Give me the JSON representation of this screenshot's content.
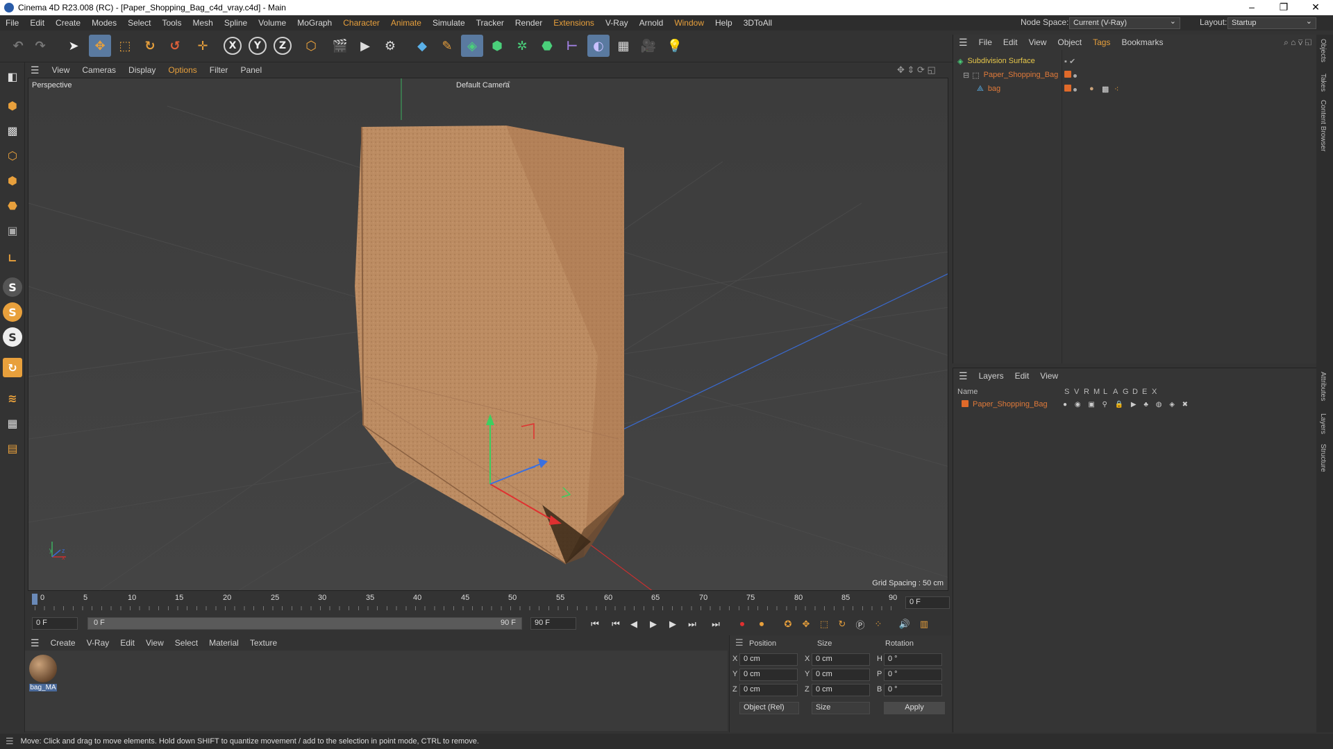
{
  "window": {
    "title": "Cinema 4D R23.008 (RC) - [Paper_Shopping_Bag_c4d_vray.c4d] - Main",
    "minimize": "–",
    "maximize": "❐",
    "close": "✕"
  },
  "menubar": {
    "items": [
      "File",
      "Edit",
      "Create",
      "Modes",
      "Select",
      "Tools",
      "Mesh",
      "Spline",
      "Volume",
      "MoGraph",
      "Character",
      "Animate",
      "Simulate",
      "Tracker",
      "Render",
      "Extensions",
      "V-Ray",
      "Arnold",
      "Window",
      "Help",
      "3DToAll"
    ],
    "node_space_label": "Node Space:",
    "node_space_value": "Current (V-Ray)",
    "layout_label": "Layout:",
    "layout_value": "Startup"
  },
  "toolbar": {
    "axis_x": "X",
    "axis_y": "Y",
    "axis_z": "Z"
  },
  "viewport_menu": {
    "items": [
      "View",
      "Cameras",
      "Display",
      "Options",
      "Filter",
      "Panel"
    ]
  },
  "viewport": {
    "view_name": "Perspective",
    "camera": "Default Camera",
    "grid_spacing": "Grid Spacing : 50 cm",
    "axis_y": "y",
    "axis_z": "z",
    "axis_x": "x"
  },
  "timeline": {
    "ticks": [
      "0",
      "5",
      "10",
      "15",
      "20",
      "25",
      "30",
      "35",
      "40",
      "45",
      "50",
      "55",
      "60",
      "65",
      "70",
      "75",
      "80",
      "85",
      "90"
    ],
    "current_frame": "0 F",
    "start_frame": "0 F",
    "range_start": "0 F",
    "range_end": "90 F",
    "end_frame": "90 F"
  },
  "material_menu": {
    "items": [
      "Create",
      "V-Ray",
      "Edit",
      "View",
      "Select",
      "Material",
      "Texture"
    ]
  },
  "materials": [
    {
      "name": "bag_MA"
    }
  ],
  "coords": {
    "headers": [
      "Position",
      "Size",
      "Rotation"
    ],
    "rows": [
      {
        "axis": "X",
        "pos": "0 cm",
        "size_axis": "X",
        "size": "0 cm",
        "rot_axis": "H",
        "rot": "0 °"
      },
      {
        "axis": "Y",
        "pos": "0 cm",
        "size_axis": "Y",
        "size": "0 cm",
        "rot_axis": "P",
        "rot": "0 °"
      },
      {
        "axis": "Z",
        "pos": "0 cm",
        "size_axis": "Z",
        "size": "0 cm",
        "rot_axis": "B",
        "rot": "0 °"
      }
    ],
    "mode": "Object (Rel)",
    "size_mode": "Size",
    "apply": "Apply"
  },
  "object_manager": {
    "menu": [
      "File",
      "Edit",
      "View",
      "Object",
      "Tags",
      "Bookmarks"
    ],
    "objects": [
      {
        "name": "Subdivision Surface",
        "color": "#e8c84a"
      },
      {
        "name": "Paper_Shopping_Bag",
        "color": "#e07a3a"
      },
      {
        "name": "bag",
        "color": "#e07a3a"
      }
    ]
  },
  "layer_manager": {
    "menu": [
      "Layers",
      "Edit",
      "View"
    ],
    "columns": [
      "Name",
      "S",
      "V",
      "R",
      "M",
      "L",
      "A",
      "G",
      "D",
      "E",
      "X"
    ],
    "layers": [
      {
        "name": "Paper_Shopping_Bag"
      }
    ]
  },
  "side_tabs": [
    "Objects",
    "Takes",
    "Content Browser",
    "Attributes",
    "Layers",
    "Structure"
  ],
  "status": {
    "message": "Move: Click and drag to move elements. Hold down SHIFT to quantize movement / add to the selection in point mode, CTRL to remove."
  },
  "colors": {
    "accent_orange": "#e8a03c",
    "active_blue": "#5a7aa0",
    "bag": "#b98a62"
  }
}
